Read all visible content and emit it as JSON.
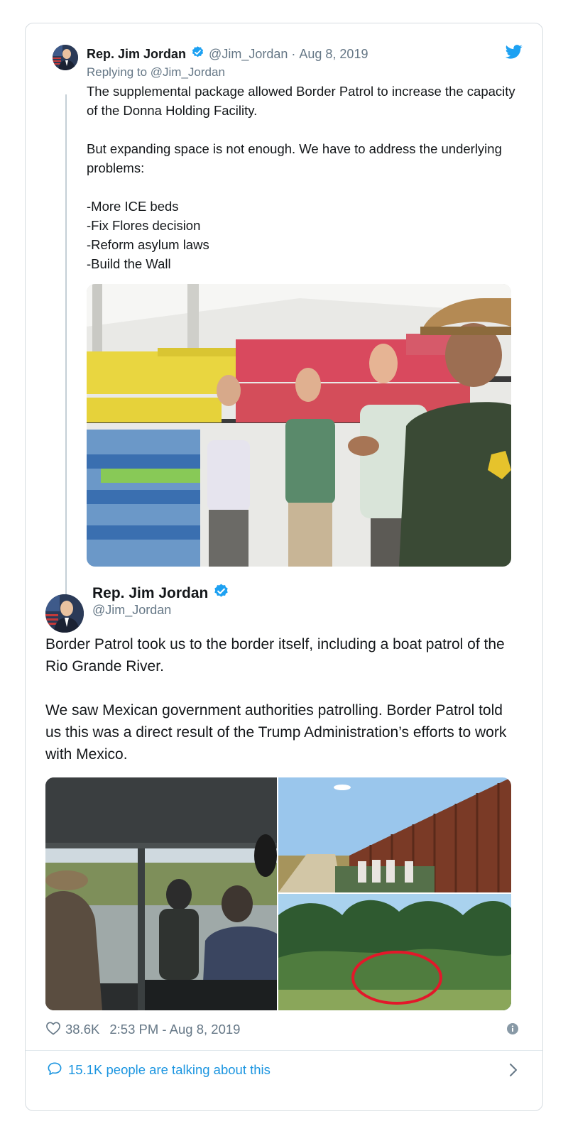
{
  "quoted_tweet": {
    "author_name": "Rep. Jim Jordan",
    "handle": "@Jim_Jordan",
    "separator": "·",
    "date": "Aug 8, 2019",
    "replying_to": "Replying to @Jim_Jordan",
    "text": "The supplemental package allowed Border Patrol to increase the capacity of the Donna Holding Facility.\n\nBut expanding space is not enough. We have to address the underlying problems:\n\n-More ICE beds\n-Fix Flores decision\n-Reform asylum laws\n-Build the Wall"
  },
  "main_tweet": {
    "author_name": "Rep. Jim Jordan",
    "handle": "@Jim_Jordan",
    "text": "Border Patrol took us to the border itself, including a boat patrol of the Rio Grande River.\n\nWe saw Mexican government authorities patrolling. Border Patrol told us this was a direct result of the Trump Administration’s efforts to work with Mexico.",
    "likes": "38.6K",
    "time": "2:53 PM - Aug 8, 2019",
    "talking": "15.1K people are talking about this"
  },
  "icons": {
    "verified": "verified-badge-icon",
    "bird": "twitter-bird-icon",
    "heart": "heart-icon",
    "info": "info-icon",
    "bubble": "speech-bubble-icon",
    "chevron": "chevron-right-icon"
  },
  "colors": {
    "brand": "#1da1f2",
    "link": "#1b95e0",
    "muted": "#657786",
    "text": "#14171a",
    "border": "#d6dce1"
  }
}
